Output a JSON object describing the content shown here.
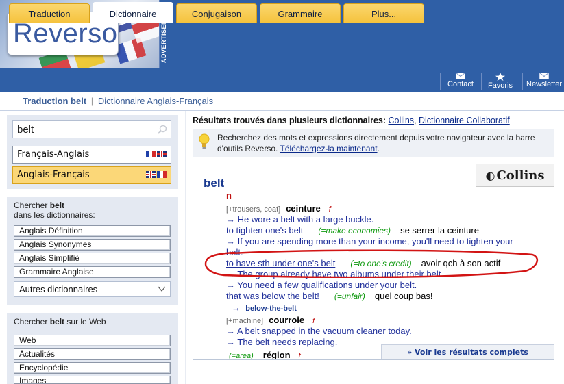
{
  "brand": {
    "logo": "Reverso",
    "advertisement_label": "ADVERTISEMENT"
  },
  "nav": {
    "tabs": [
      {
        "label": "Traduction",
        "active": false
      },
      {
        "label": "Dictionnaire",
        "active": true
      },
      {
        "label": "Conjugaison",
        "active": false
      },
      {
        "label": "Grammaire",
        "active": false
      },
      {
        "label": "Plus...",
        "active": false
      }
    ],
    "links": [
      {
        "label": "Contact",
        "icon": "envelope-icon"
      },
      {
        "label": "Favoris",
        "icon": "star-icon"
      },
      {
        "label": "Newsletter",
        "icon": "envelope-icon"
      }
    ]
  },
  "breadcrumb": {
    "current": "Traduction belt",
    "separator": "|",
    "section": "Dictionnaire Anglais-Français"
  },
  "sidebar": {
    "search_value": "belt",
    "dictionaries": [
      {
        "label": "Français-Anglais",
        "selected": false
      },
      {
        "label": "Anglais-Français",
        "selected": true
      }
    ],
    "dict_panel": {
      "prefix": "Chercher",
      "word": "belt",
      "suffix": "dans les dictionnaires:"
    },
    "dict_links": [
      "Anglais Définition",
      "Anglais Synonymes",
      "Anglais Simplifié",
      "Grammaire Anglaise"
    ],
    "other_dicts_label": "Autres dictionnaires",
    "web_panel": {
      "prefix": "Chercher",
      "word": "belt",
      "suffix": "sur le Web"
    },
    "web_links": [
      "Web",
      "Actualités",
      "Encyclopédie",
      "Images"
    ]
  },
  "results": {
    "prefix": "Résultats trouvés dans plusieurs dictionnaires:",
    "source_1": "Collins",
    "separator": ",",
    "source_2": "Dictionnaire Collaboratif"
  },
  "tip": {
    "text": "Recherchez des mots et expressions directement depuis votre navigateur avec la barre d'outils Reverso.",
    "link": "Téléchargez-la maintenant",
    "end": "."
  },
  "entry": {
    "source_badge": "Collins",
    "headword": "belt",
    "pos": "n",
    "sense1": {
      "context": "[+trousers, coat]",
      "translation": "ceinture",
      "gender": "f"
    },
    "ex1": "→ He wore a belt with a large buckle.",
    "phrase1": {
      "phrase": "to tighten one's belt",
      "gloss": "(=make economies)",
      "translation": "se serrer la ceinture"
    },
    "ex2": "→ If you are spending more than your income, you'll need to tighten your",
    "ex2b": "belt.",
    "phrase2": {
      "phrase": "to have sth under one's belt",
      "gloss": "(=to one's credit)",
      "translation": "avoir qch à son actif"
    },
    "ex3": "→ The group already have two albums under their belt.",
    "ex4": "→ You need a few qualifications under your belt.",
    "phrase3": {
      "phrase": "that was below the belt!",
      "gloss": "(=unfair)",
      "translation": "quel coup bas!"
    },
    "xref": {
      "arrow": "→",
      "label": "below-the-belt"
    },
    "sense2": {
      "context": "[+machine]",
      "translation": "courroie",
      "gender": "f"
    },
    "ex5": "→ A belt snapped in the vacuum cleaner today.",
    "ex6": "→ The belt needs replacing.",
    "sense3": {
      "context": "(=area)",
      "translation": "région",
      "gender": "f"
    },
    "more_link": "» Voir les résultats complets"
  },
  "colors": {
    "nav_blue": "#2f5fa6",
    "tab_yellow": "#f5c23c",
    "link_blue": "#1f2f9a",
    "gloss_green": "#119a11",
    "gender_red": "#c01010",
    "annotation_red": "#d21414"
  }
}
